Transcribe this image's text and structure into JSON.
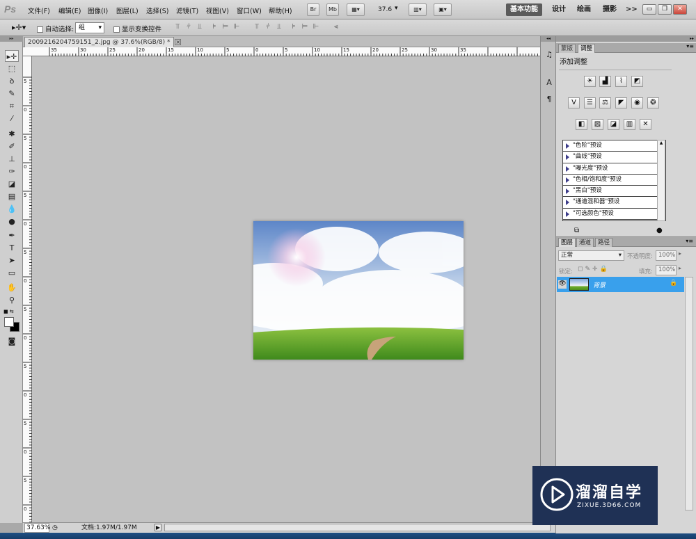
{
  "app": {
    "logo": "Ps"
  },
  "menu": [
    "文件(F)",
    "编辑(E)",
    "图像(I)",
    "图层(L)",
    "选择(S)",
    "滤镜(T)",
    "视图(V)",
    "窗口(W)",
    "帮助(H)"
  ],
  "appbar": {
    "br_label": "Br",
    "mb_label": "Mb",
    "zoom": "37.6"
  },
  "workspaces": [
    "基本功能",
    "设计",
    "绘画",
    "摄影",
    ">>"
  ],
  "options": {
    "auto_select_label": "自动选择:",
    "auto_select_value": "组",
    "show_transform_label": "显示变换控件"
  },
  "document": {
    "tab_title": "2009216204759151_2.jpg @ 37.6%(RGB/8) *",
    "tab_close": "×",
    "ruler_top": [
      "35",
      "30",
      "25",
      "20",
      "15",
      "10",
      "5",
      "0",
      "5",
      "10",
      "15",
      "20",
      "25",
      "30",
      "35"
    ],
    "ruler_left": [
      "5",
      "0",
      "5",
      "0",
      "5",
      "0",
      "5",
      "0",
      "5",
      "0",
      "5",
      "0",
      "5",
      "0",
      "5",
      "0"
    ]
  },
  "status": {
    "zoom": "37.63%",
    "doc_info": "文档:1.97M/1.97M"
  },
  "adjustments_panel": {
    "tabs": [
      "蒙版",
      "调整"
    ],
    "title": "添加调整",
    "icon_row1": [
      "brightness-contrast-icon",
      "levels-icon",
      "curves-icon",
      "exposure-icon"
    ],
    "icon_row2": [
      "vibrance-icon",
      "hue-saturation-icon",
      "color-balance-icon",
      "black-white-icon",
      "photo-filter-icon",
      "channel-mixer-icon"
    ],
    "icon_row3": [
      "invert-icon",
      "posterize-icon",
      "threshold-icon",
      "gradient-map-icon",
      "selective-color-icon"
    ],
    "presets": [
      "\"色阶\"预设",
      "\"曲线\"预设",
      "\"曝光度\"预设",
      "\"色相/饱和度\"预设",
      "\"黑白\"预设",
      "\"通道混和器\"预设",
      "\"可选颜色\"预设"
    ]
  },
  "layers_panel": {
    "tabs": [
      "图层",
      "通道",
      "路径"
    ],
    "blend_mode": "正常",
    "opacity_label": "不透明度:",
    "opacity_value": "100%",
    "lock_label": "锁定:",
    "fill_label": "填充:",
    "fill_value": "100%",
    "layers": [
      {
        "name": "背景"
      }
    ]
  },
  "watermark": {
    "title": "溜溜自学",
    "subtitle": "ZIXUE.3D66.COM"
  },
  "colors": {
    "selection_blue": "#39a0ec",
    "canvas_gray": "#c2c2c2",
    "panel_gray": "#d6d6d6"
  }
}
